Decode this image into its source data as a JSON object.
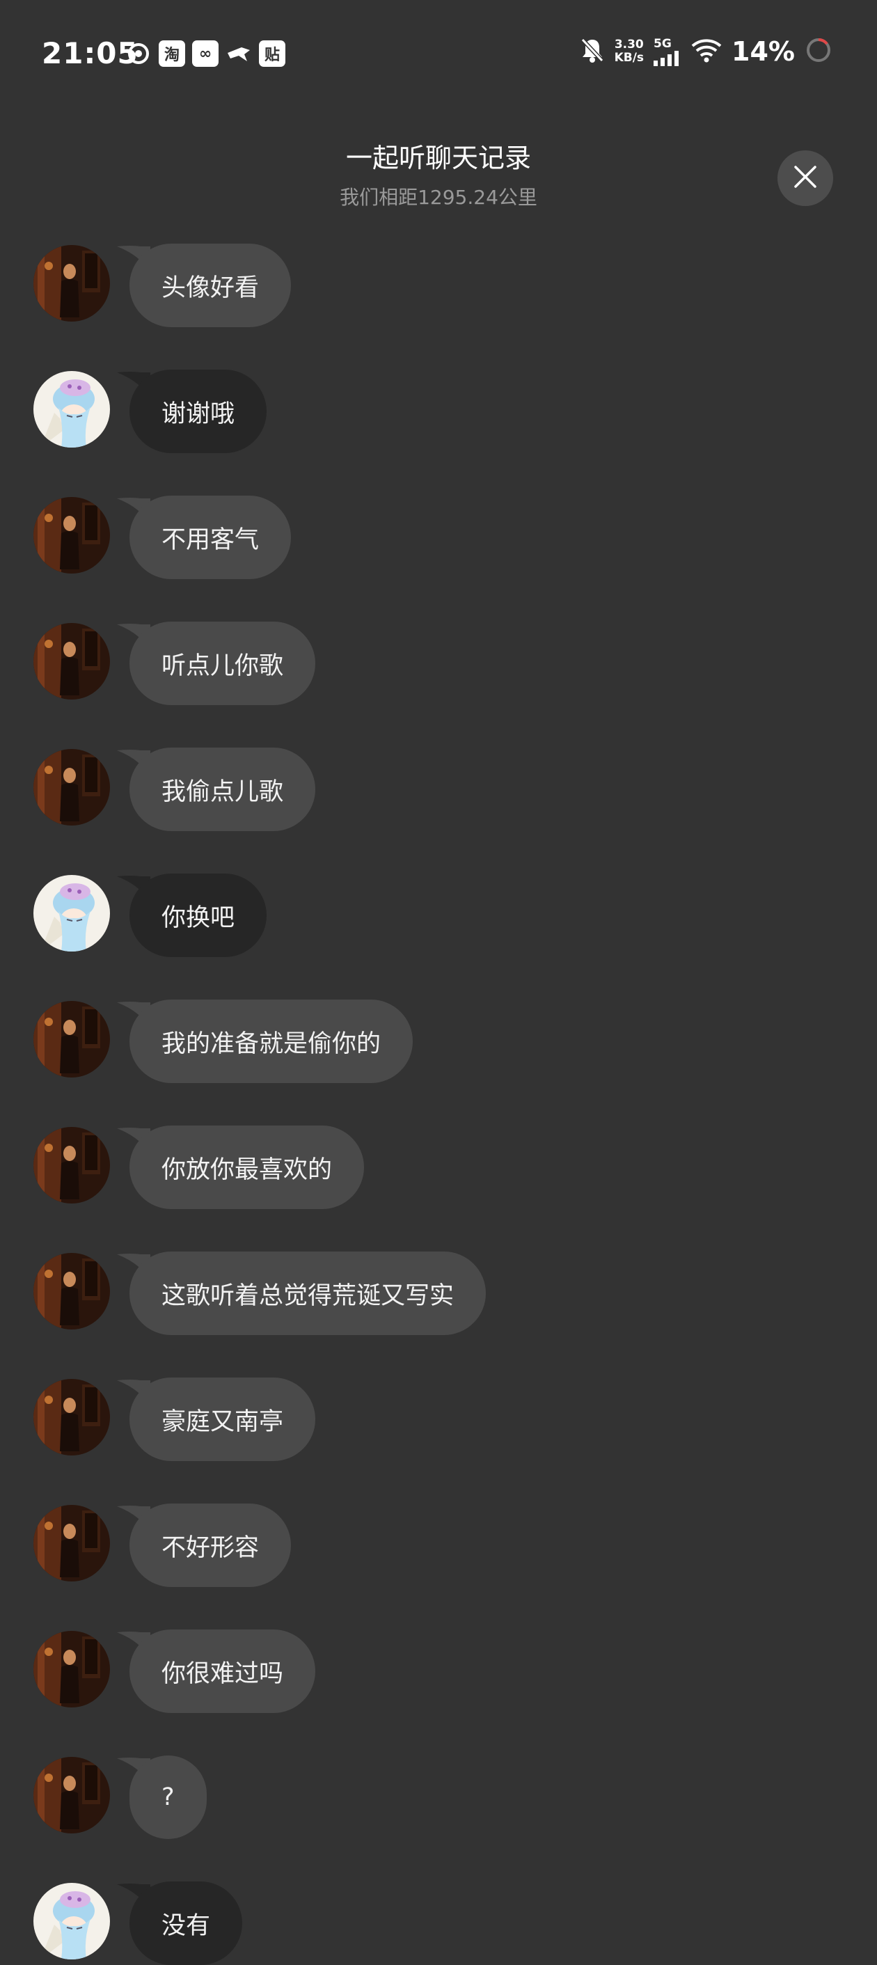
{
  "status_bar": {
    "time": "21:05",
    "app_icons": [
      {
        "name": "weibo-icon",
        "glyph": "◎"
      },
      {
        "name": "taobao-icon",
        "glyph": "淘"
      },
      {
        "name": "baidu-netdisk-icon",
        "glyph": "∞"
      },
      {
        "name": "xianyu-icon",
        "glyph": "✈"
      },
      {
        "name": "tieba-icon",
        "glyph": "贴"
      }
    ],
    "net_speed_value": "3.30",
    "net_speed_unit": "KB/s",
    "network_type": "5G",
    "battery": "14%",
    "colors": {
      "battery_ring": "#e04848"
    }
  },
  "header": {
    "title": "一起听聊天记录",
    "subtitle": "我们相距1295.24公里"
  },
  "messages": [
    {
      "sender": "other",
      "text": "头像好看"
    },
    {
      "sender": "self",
      "text": "谢谢哦"
    },
    {
      "sender": "other",
      "text": "不用客气"
    },
    {
      "sender": "other",
      "text": "听点儿你歌"
    },
    {
      "sender": "other",
      "text": "我偷点儿歌"
    },
    {
      "sender": "self",
      "text": "你换吧"
    },
    {
      "sender": "other",
      "text": "我的准备就是偷你的"
    },
    {
      "sender": "other",
      "text": "你放你最喜欢的"
    },
    {
      "sender": "other",
      "text": "这歌听着总觉得荒诞又写实"
    },
    {
      "sender": "other",
      "text": "豪庭又南亭"
    },
    {
      "sender": "other",
      "text": "不好形容"
    },
    {
      "sender": "other",
      "text": "你很难过吗"
    },
    {
      "sender": "other",
      "text": "?"
    },
    {
      "sender": "self",
      "text": "没有"
    }
  ],
  "colors": {
    "background": "#333333",
    "bubble_other": "#4a4a4a",
    "bubble_self": "#262626"
  }
}
